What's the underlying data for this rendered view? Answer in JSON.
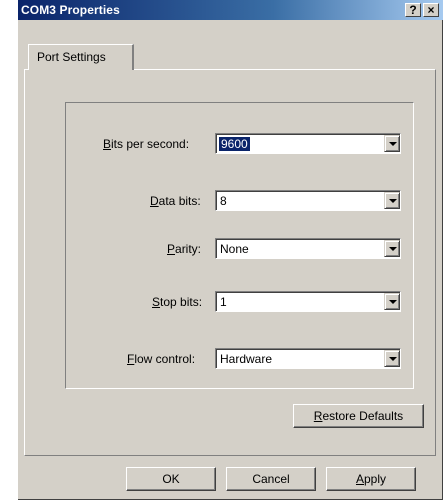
{
  "window": {
    "title": "COM3 Properties",
    "help_label": "?",
    "close_label": "×"
  },
  "tabs": [
    {
      "label": "Port Settings",
      "active": true
    }
  ],
  "fields": {
    "bits_per_second": {
      "label_pre": "",
      "label_mnemonic": "B",
      "label_post": "its per second:",
      "value": "9600"
    },
    "data_bits": {
      "label_pre": "",
      "label_mnemonic": "D",
      "label_post": "ata bits:",
      "value": "8"
    },
    "parity": {
      "label_pre": "",
      "label_mnemonic": "P",
      "label_post": "arity:",
      "value": "None"
    },
    "stop_bits": {
      "label_pre": "",
      "label_mnemonic": "S",
      "label_post": "top bits:",
      "value": "1"
    },
    "flow_control": {
      "label_pre": "",
      "label_mnemonic": "F",
      "label_post": "low control:",
      "value": "Hardware"
    }
  },
  "buttons": {
    "restore_mnemonic": "R",
    "restore_rest": "estore Defaults",
    "ok": "OK",
    "cancel": "Cancel",
    "apply_mnemonic": "A",
    "apply_rest": "pply"
  },
  "colors": {
    "titlebar_start": "#0a246a",
    "titlebar_end": "#a6caf0",
    "face": "#d4d0c8",
    "selection": "#0a246a"
  }
}
